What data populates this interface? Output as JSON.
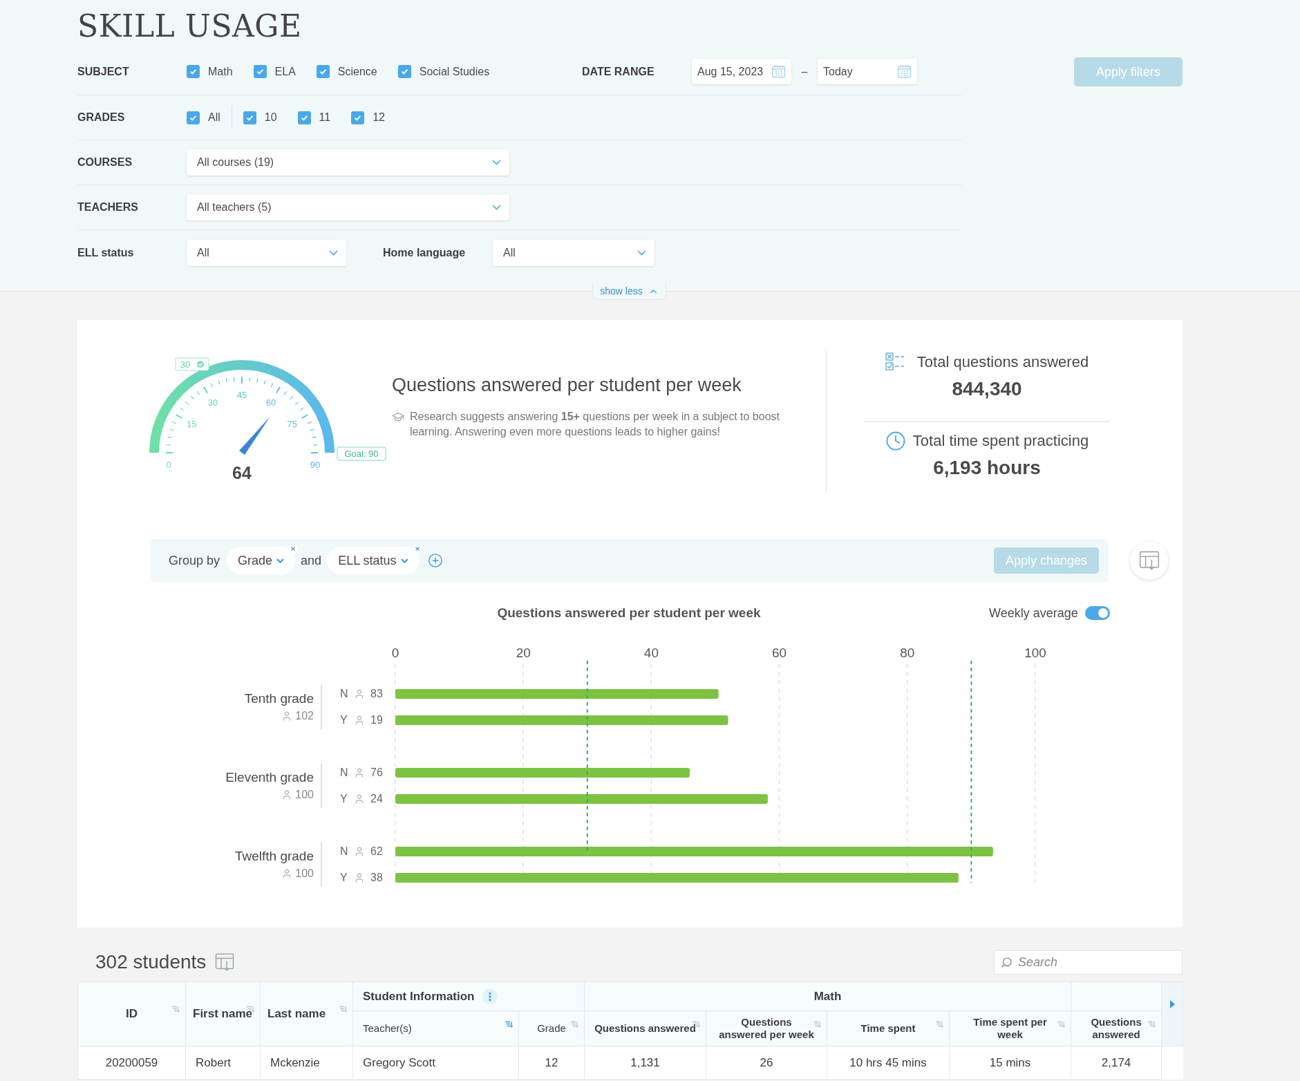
{
  "title": "SKILL USAGE",
  "filters": {
    "subject": {
      "label": "SUBJECT",
      "options": [
        {
          "label": "Math",
          "checked": true
        },
        {
          "label": "ELA",
          "checked": true
        },
        {
          "label": "Science",
          "checked": true
        },
        {
          "label": "Social Studies",
          "checked": true
        }
      ]
    },
    "date_range": {
      "label": "DATE RANGE",
      "from": "Aug 15, 2023",
      "separator": "–",
      "to": "Today"
    },
    "apply_button": {
      "label": "Apply filters",
      "disabled": true
    },
    "grades": {
      "label": "GRADES",
      "options": [
        {
          "label": "All",
          "checked": true
        },
        {
          "label": "10",
          "checked": true
        },
        {
          "label": "11",
          "checked": true
        },
        {
          "label": "12",
          "checked": true
        }
      ]
    },
    "courses": {
      "label": "COURSES",
      "value": "All courses (19)"
    },
    "teachers": {
      "label": "TEACHERS",
      "value": "All teachers (5)"
    },
    "ell_status": {
      "label": "ELL status",
      "value": "All"
    },
    "home_language": {
      "label": "Home language",
      "value": "All"
    },
    "toggle_link": "show less"
  },
  "gauge": {
    "badge": "30",
    "ticks": [
      "0",
      "15",
      "30",
      "45",
      "60",
      "75",
      "90"
    ],
    "value": "64",
    "goal": "Goal: 90"
  },
  "summary": {
    "title": "Questions answered per student per week",
    "note": "Research suggests answering **15+** questions per week in a subject to boost learning. Answering even more questions leads to higher gains!"
  },
  "stats": [
    {
      "kind": "questions",
      "label": "Total questions answered",
      "value": "844,340"
    },
    {
      "kind": "time",
      "label": "Total time spent practicing",
      "value": "6,193 hours"
    }
  ],
  "group_by": {
    "label": "Group by",
    "chips": [
      "Grade",
      "ELL status"
    ],
    "joiner": "and",
    "apply_button": {
      "label": "Apply changes",
      "disabled": true
    }
  },
  "chart": {
    "weekly_average": {
      "label": "Weekly average",
      "on": true
    },
    "groups": [
      {
        "label": "Tenth grade",
        "count": "102",
        "rows": [
          {
            "label": "N",
            "count": "83"
          },
          {
            "label": "Y",
            "count": "19"
          }
        ]
      },
      {
        "label": "Eleventh grade",
        "count": "100",
        "rows": [
          {
            "label": "N",
            "count": "76"
          },
          {
            "label": "Y",
            "count": "24"
          }
        ]
      },
      {
        "label": "Twelfth grade",
        "count": "100",
        "rows": [
          {
            "label": "N",
            "count": "62"
          },
          {
            "label": "Y",
            "count": "38"
          }
        ]
      }
    ],
    "chart_data": {
      "type": "bar",
      "orientation": "horizontal",
      "title": "Questions answered per student per week",
      "xlim": [
        0,
        100
      ],
      "xticks": [
        0,
        20,
        40,
        60,
        80,
        100
      ],
      "grid": true,
      "series": [
        {
          "color": "#7dc242",
          "values": [
            50.5,
            52,
            46,
            58.2,
            93.4,
            88
          ]
        }
      ],
      "ref_lines": [
        {
          "axis": "x",
          "value": 30
        },
        {
          "axis": "x",
          "value": 90
        }
      ]
    }
  },
  "table": {
    "count": "302 students",
    "search_placeholder": "Search",
    "ungrouped_columns": [
      {
        "label": "ID",
        "sorted": false
      },
      {
        "label": "First name",
        "sorted": false
      },
      {
        "label": "Last name",
        "sorted": false
      }
    ],
    "groups": [
      {
        "label": "Student Information",
        "menu": true,
        "columns": [
          {
            "label": "Teacher(s)",
            "sorted": true
          },
          {
            "label": "Grade",
            "sorted": false
          }
        ]
      },
      {
        "label": "Math",
        "menu": false,
        "columns": [
          {
            "label": "Questions answered",
            "sorted": false
          },
          {
            "label": "Questions answered per week",
            "sorted": false
          },
          {
            "label": "Time spent",
            "sorted": false
          },
          {
            "label": "Time spent per week",
            "sorted": false
          }
        ]
      },
      {
        "menu": false,
        "columns": [
          {
            "label": "Questions answered",
            "sorted": false
          }
        ]
      }
    ],
    "rows": [
      {
        "cells": [
          "20200059",
          "Robert",
          "Mckenzie",
          "Gregory Scott",
          "12",
          "1,131",
          "26",
          "10 hrs 45 mins",
          "15 mins",
          "2,174"
        ]
      }
    ]
  }
}
